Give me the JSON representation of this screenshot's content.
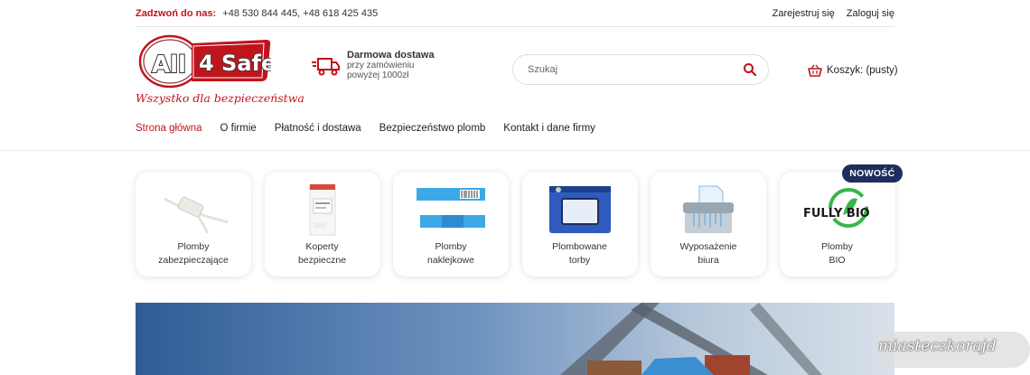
{
  "topbar": {
    "call_label": "Zadzwoń do nas:",
    "phones": "+48 530 844 445, +48 618 425 435",
    "register": "Zarejestruj się",
    "login": "Zaloguj się"
  },
  "logo": {
    "left_text": "All",
    "right_text": "4 Safe",
    "tagline": "Wszystko dla bezpieczeństwa",
    "colors": {
      "red": "#c0141d",
      "dark": "#333333"
    }
  },
  "delivery": {
    "icon": "truck-icon",
    "title": "Darmowa dostawa",
    "line1": "przy zamówieniu",
    "line2": "powyżej 1000zł"
  },
  "search": {
    "placeholder": "Szukaj",
    "icon": "search-icon"
  },
  "cart": {
    "icon": "basket-icon",
    "label": "Koszyk: (pusty)"
  },
  "nav": {
    "items": [
      {
        "label": "Strona główna"
      },
      {
        "label": "O firmie"
      },
      {
        "label": "Płatność i dostawa"
      },
      {
        "label": "Bezpieczeństwo plomb"
      },
      {
        "label": "Kontakt i dane firmy"
      }
    ],
    "active_color": "#c0141d"
  },
  "categories": [
    {
      "line1": "Plomby",
      "line2": "zabezpieczające"
    },
    {
      "line1": "Koperty",
      "line2": "bezpieczne"
    },
    {
      "line1": "Plomby",
      "line2": "naklejkowe"
    },
    {
      "line1": "Plombowane",
      "line2": "torby"
    },
    {
      "line1": "Wyposażenie",
      "line2": "biura"
    },
    {
      "line1": "Plomby",
      "line2": "BIO",
      "badge": "NOWOŚĆ",
      "image_text": "FULLY BIO"
    }
  ],
  "watermark": "miasteczkorajd"
}
